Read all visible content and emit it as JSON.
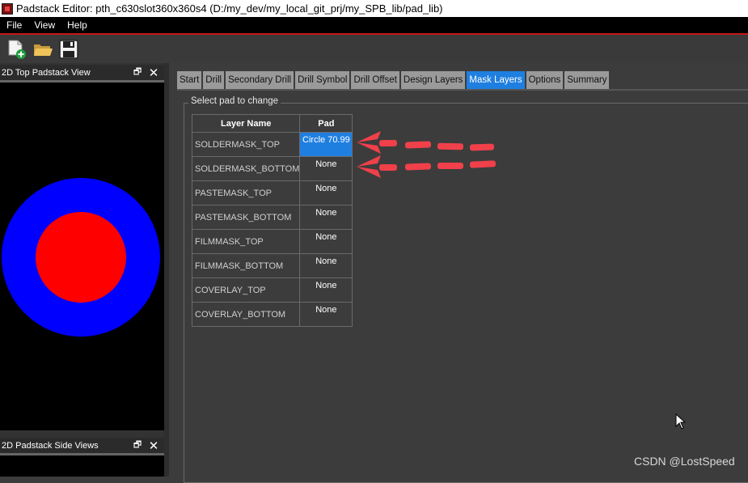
{
  "window": {
    "title": "Padstack Editor: pth_c630slot360x360s4  (D:/my_dev/my_local_git_prj/my_SPB_lib/pad_lib)"
  },
  "menu": [
    "File",
    "View",
    "Help"
  ],
  "toolbar": {
    "icons": [
      "new-file-icon",
      "open-folder-icon",
      "save-icon"
    ]
  },
  "left_dock": {
    "top_view_title": "2D Top Padstack View",
    "side_view_title": "2D Padstack Side Views",
    "float_symbol": "🗗",
    "close_symbol": "✕",
    "pad_outer_color": "#0000ff",
    "pad_inner_color": "#ff0000"
  },
  "tabs": [
    {
      "label": "Start",
      "active": false
    },
    {
      "label": "Drill",
      "active": false
    },
    {
      "label": "Secondary Drill",
      "active": false
    },
    {
      "label": "Drill Symbol",
      "active": false
    },
    {
      "label": "Drill Offset",
      "active": false
    },
    {
      "label": "Design Layers",
      "active": false
    },
    {
      "label": "Mask Layers",
      "active": true
    },
    {
      "label": "Options",
      "active": false
    },
    {
      "label": "Summary",
      "active": false
    }
  ],
  "mask_layers": {
    "group_label": "Select pad to change",
    "header_layer": "Layer Name",
    "header_pad": "Pad",
    "rows": [
      {
        "layer": "SOLDERMASK_TOP",
        "pad": "Circle 70.99",
        "selected": true
      },
      {
        "layer": "SOLDERMASK_BOTTOM",
        "pad": "None",
        "selected": false
      },
      {
        "layer": "PASTEMASK_TOP",
        "pad": "None",
        "selected": false
      },
      {
        "layer": "PASTEMASK_BOTTOM",
        "pad": "None",
        "selected": false
      },
      {
        "layer": "FILMMASK_TOP",
        "pad": "None",
        "selected": false
      },
      {
        "layer": "FILMMASK_BOTTOM",
        "pad": "None",
        "selected": false
      },
      {
        "layer": "COVERLAY_TOP",
        "pad": "None",
        "selected": false
      },
      {
        "layer": "COVERLAY_BOTTOM",
        "pad": "None",
        "selected": false
      }
    ]
  },
  "watermark": "CSDN @LostSpeed",
  "colors": {
    "accent": "#1f7fe0",
    "annotation_arrow": "#f0404a"
  }
}
